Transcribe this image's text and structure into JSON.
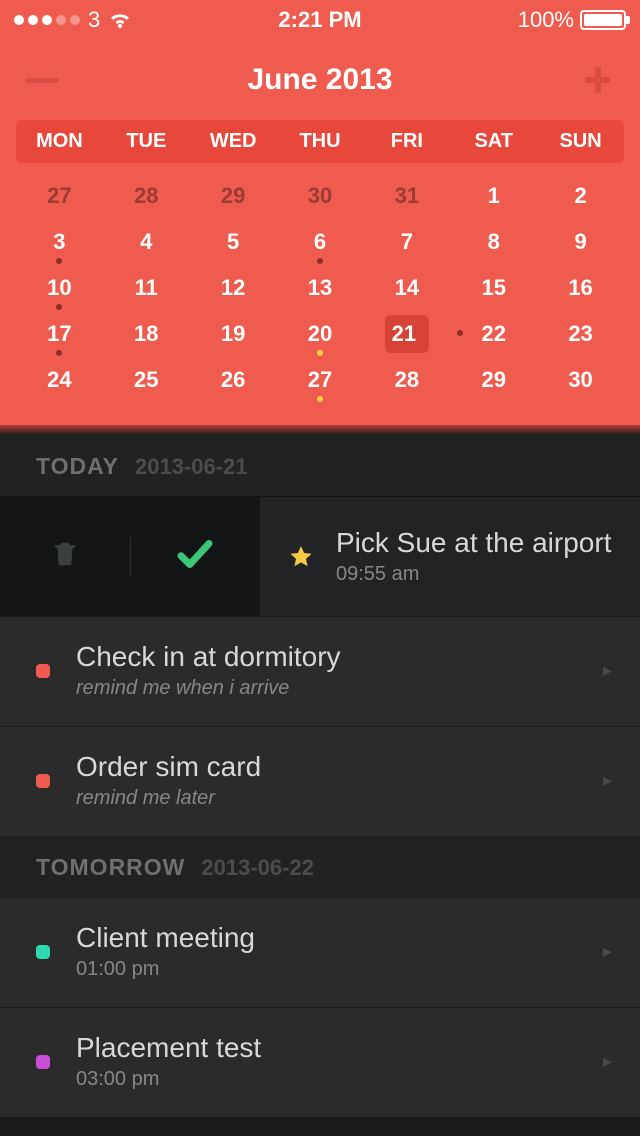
{
  "status": {
    "carrier": "3",
    "time": "2:21 PM",
    "battery": "100%"
  },
  "header": {
    "title": "June 2013"
  },
  "calendar": {
    "weekdays": [
      "MON",
      "TUE",
      "WED",
      "THU",
      "FRI",
      "SAT",
      "SUN"
    ],
    "cells": [
      {
        "n": "27",
        "prev": true
      },
      {
        "n": "28",
        "prev": true
      },
      {
        "n": "29",
        "prev": true
      },
      {
        "n": "30",
        "prev": true
      },
      {
        "n": "31",
        "prev": true
      },
      {
        "n": "1"
      },
      {
        "n": "2"
      },
      {
        "n": "3",
        "dot": "red"
      },
      {
        "n": "4"
      },
      {
        "n": "5"
      },
      {
        "n": "6",
        "dot": "red"
      },
      {
        "n": "7"
      },
      {
        "n": "8"
      },
      {
        "n": "9"
      },
      {
        "n": "10",
        "dot": "red"
      },
      {
        "n": "11"
      },
      {
        "n": "12"
      },
      {
        "n": "13"
      },
      {
        "n": "14"
      },
      {
        "n": "15"
      },
      {
        "n": "16"
      },
      {
        "n": "17",
        "dot": "red"
      },
      {
        "n": "18"
      },
      {
        "n": "19"
      },
      {
        "n": "20",
        "dot": "yellow"
      },
      {
        "n": "21",
        "selected": true,
        "dot": "red"
      },
      {
        "n": "22"
      },
      {
        "n": "23"
      },
      {
        "n": "24"
      },
      {
        "n": "25"
      },
      {
        "n": "26"
      },
      {
        "n": "27",
        "dot": "yellow"
      },
      {
        "n": "28"
      },
      {
        "n": "29"
      },
      {
        "n": "30"
      }
    ]
  },
  "sections": {
    "today": {
      "label": "TODAY",
      "date": "2013-06-21"
    },
    "tomorrow": {
      "label": "TOMORROW",
      "date": "2013-06-22"
    }
  },
  "tasks": {
    "t0": {
      "title": "Pick Sue at the airport",
      "sub": "09:55 am"
    },
    "t1": {
      "title": "Check in at dormitory",
      "sub": "remind me when i arrive"
    },
    "t2": {
      "title": "Order sim card",
      "sub": "remind me later"
    },
    "t3": {
      "title": "Client meeting",
      "sub": "01:00 pm"
    },
    "t4": {
      "title": "Placement test",
      "sub": "03:00 pm"
    }
  }
}
